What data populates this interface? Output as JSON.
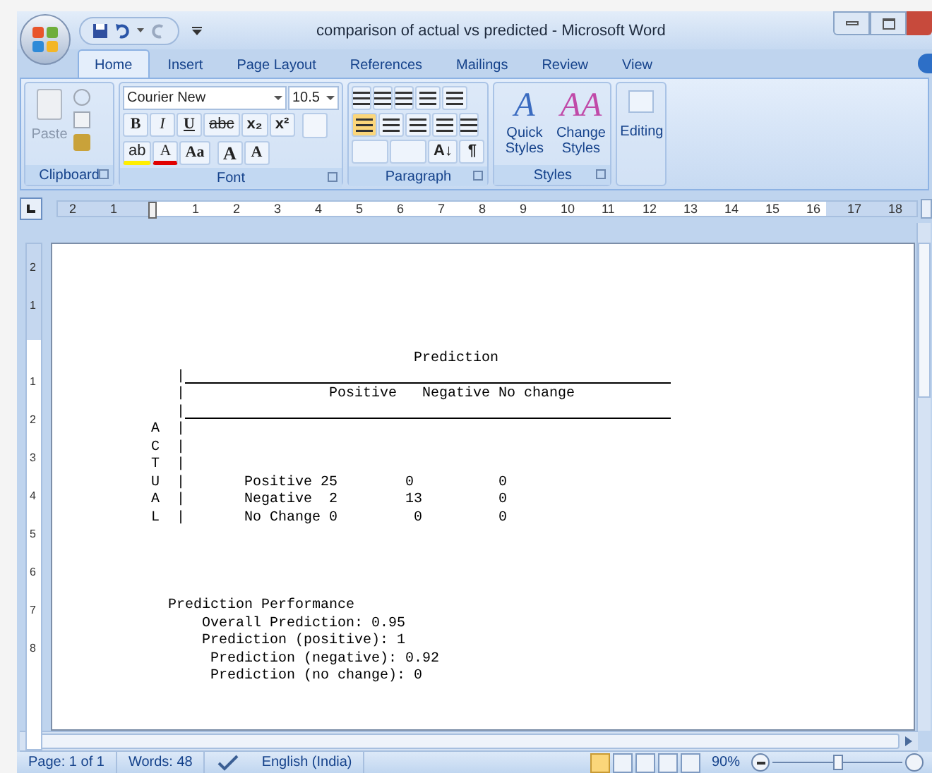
{
  "window": {
    "title": "comparison of actual vs predicted - Microsoft Word"
  },
  "tabs": [
    {
      "label": "Home",
      "selected": true
    },
    {
      "label": "Insert",
      "selected": false
    },
    {
      "label": "Page Layout",
      "selected": false
    },
    {
      "label": "References",
      "selected": false
    },
    {
      "label": "Mailings",
      "selected": false
    },
    {
      "label": "Review",
      "selected": false
    },
    {
      "label": "View",
      "selected": false
    }
  ],
  "ribbon": {
    "clipboard": {
      "label": "Clipboard",
      "paste": "Paste"
    },
    "font": {
      "label": "Font",
      "font_name": "Courier New",
      "font_size": "10.5",
      "bold": "B",
      "italic": "I",
      "underline": "U",
      "strikethrough": "abc",
      "subscript": "x₂",
      "superscript": "x²",
      "highlight": "ab",
      "font_color": "A",
      "change_case": "Aa",
      "grow": "A",
      "shrink": "A"
    },
    "paragraph": {
      "label": "Paragraph",
      "sort": "A↓",
      "pilcrow": "¶"
    },
    "styles": {
      "label": "Styles",
      "quick_styles": "Quick Styles",
      "change_styles": "Change Styles",
      "quick_icon": "A",
      "change_icon": "AA"
    },
    "editing": {
      "label": "Editing"
    }
  },
  "ruler": {
    "labels": [
      "2",
      "1",
      "1",
      "2",
      "3",
      "4",
      "5",
      "6",
      "7",
      "8",
      "9",
      "10",
      "11",
      "12",
      "13",
      "14",
      "15",
      "16",
      "17",
      "18"
    ]
  },
  "vertical_ruler": {
    "labels": [
      "2",
      "1",
      "1",
      "2",
      "3",
      "4",
      "5",
      "6",
      "7",
      "8"
    ]
  },
  "document": {
    "lines": [
      {
        "kind": "text",
        "text": "                               Prediction"
      },
      {
        "kind": "rule",
        "text": "   |"
      },
      {
        "kind": "text",
        "text": "   |                 Positive   Negative No change"
      },
      {
        "kind": "rule",
        "text": "   |"
      },
      {
        "kind": "text",
        "text": "A  |"
      },
      {
        "kind": "text",
        "text": "C  |"
      },
      {
        "kind": "text",
        "text": "T  |"
      },
      {
        "kind": "text",
        "text": "U  |       Positive 25        0          0"
      },
      {
        "kind": "text",
        "text": "A  |       Negative  2        13         0"
      },
      {
        "kind": "text",
        "text": "L  |       No Change 0         0         0"
      },
      {
        "kind": "blank"
      },
      {
        "kind": "blank"
      },
      {
        "kind": "blank"
      },
      {
        "kind": "blank"
      },
      {
        "kind": "text",
        "text": "  Prediction Performance"
      },
      {
        "kind": "text",
        "text": "      Overall Prediction: 0.95"
      },
      {
        "kind": "text",
        "text": "      Prediction (positive): 1"
      },
      {
        "kind": "text",
        "text": "       Prediction (negative): 0.92"
      },
      {
        "kind": "text",
        "text": "       Prediction (no change): 0"
      }
    ]
  },
  "status_bar": {
    "page": "Page: 1 of 1",
    "words": "Words: 48",
    "language": "English (India)",
    "zoom": "90%",
    "level": 0.5
  }
}
